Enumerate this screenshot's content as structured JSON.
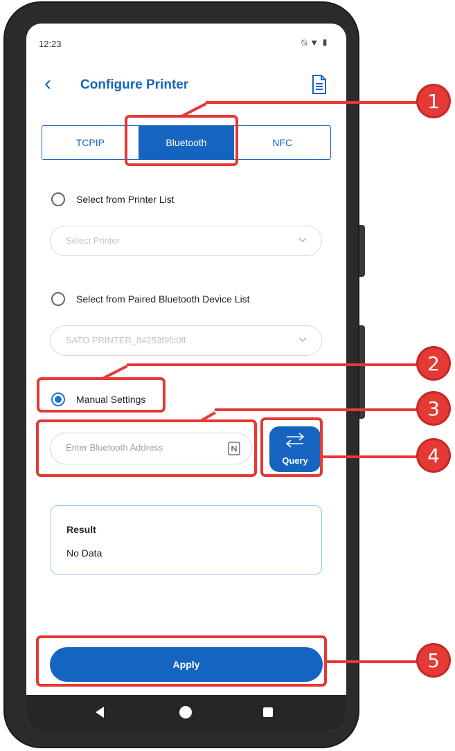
{
  "status_bar": {
    "time": "12:23",
    "icons": [
      "notification-off-icon",
      "wifi-icon",
      "battery-icon"
    ]
  },
  "app_bar": {
    "title": "Configure Printer",
    "back_icon": "back-arrow-icon",
    "action_icon": "document-icon"
  },
  "tabs": [
    {
      "label": "TCPIP",
      "active": false
    },
    {
      "label": "Bluetooth",
      "active": true
    },
    {
      "label": "NFC",
      "active": false
    }
  ],
  "options": {
    "printer_list": {
      "label": "Select from Printer List",
      "selected": false
    },
    "printer_dropdown": {
      "placeholder": "Select Printer"
    },
    "paired_list": {
      "label": "Select from Paired Bluetooth Device List",
      "selected": false
    },
    "paired_dropdown": {
      "value": "SATO PRINTER_84253f9fc0ff"
    },
    "manual": {
      "label": "Manual Settings",
      "selected": true
    }
  },
  "address_input": {
    "placeholder": "Enter Bluetooth Address",
    "value": ""
  },
  "query_button": {
    "label": "Query"
  },
  "result": {
    "title": "Result",
    "value": "No Data"
  },
  "apply_button": {
    "label": "Apply"
  },
  "callouts": [
    "1",
    "2",
    "3",
    "4",
    "5"
  ],
  "colors": {
    "accent": "#1565c0",
    "callout": "#e53935"
  }
}
